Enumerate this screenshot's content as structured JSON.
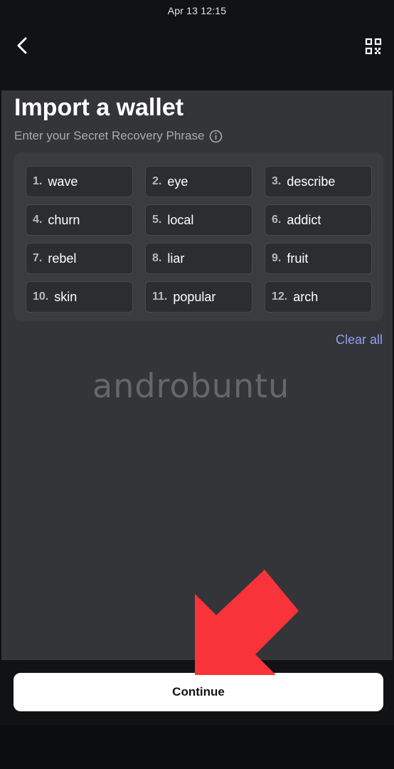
{
  "status_bar": {
    "time": "Apr 13  12:15"
  },
  "header": {
    "back_icon": "chevron-left-icon",
    "scan_icon": "qr-scan-icon"
  },
  "main": {
    "title": "Import a wallet",
    "subtitle": "Enter your Secret Recovery Phrase",
    "info_icon": "info-icon",
    "phrase_words": [
      {
        "num": "1.",
        "word": "wave"
      },
      {
        "num": "2.",
        "word": "eye"
      },
      {
        "num": "3.",
        "word": "describe"
      },
      {
        "num": "4.",
        "word": "churn"
      },
      {
        "num": "5.",
        "word": "local"
      },
      {
        "num": "6.",
        "word": "addict"
      },
      {
        "num": "7.",
        "word": "rebel"
      },
      {
        "num": "8.",
        "word": "liar"
      },
      {
        "num": "9.",
        "word": "fruit"
      },
      {
        "num": "10.",
        "word": "skin"
      },
      {
        "num": "11.",
        "word": "popular"
      },
      {
        "num": "12.",
        "word": "arch"
      }
    ],
    "clear_all_label": "Clear all",
    "watermark": "androbuntu"
  },
  "footer": {
    "continue_label": "Continue"
  },
  "overlay": {
    "arrow_icon": "red-pointer-arrow",
    "arrow_color": "#f8333a"
  },
  "colors": {
    "background": "#343538",
    "chip": "#2c2d30",
    "link": "#8f9ff3",
    "button": "#ffffff"
  }
}
